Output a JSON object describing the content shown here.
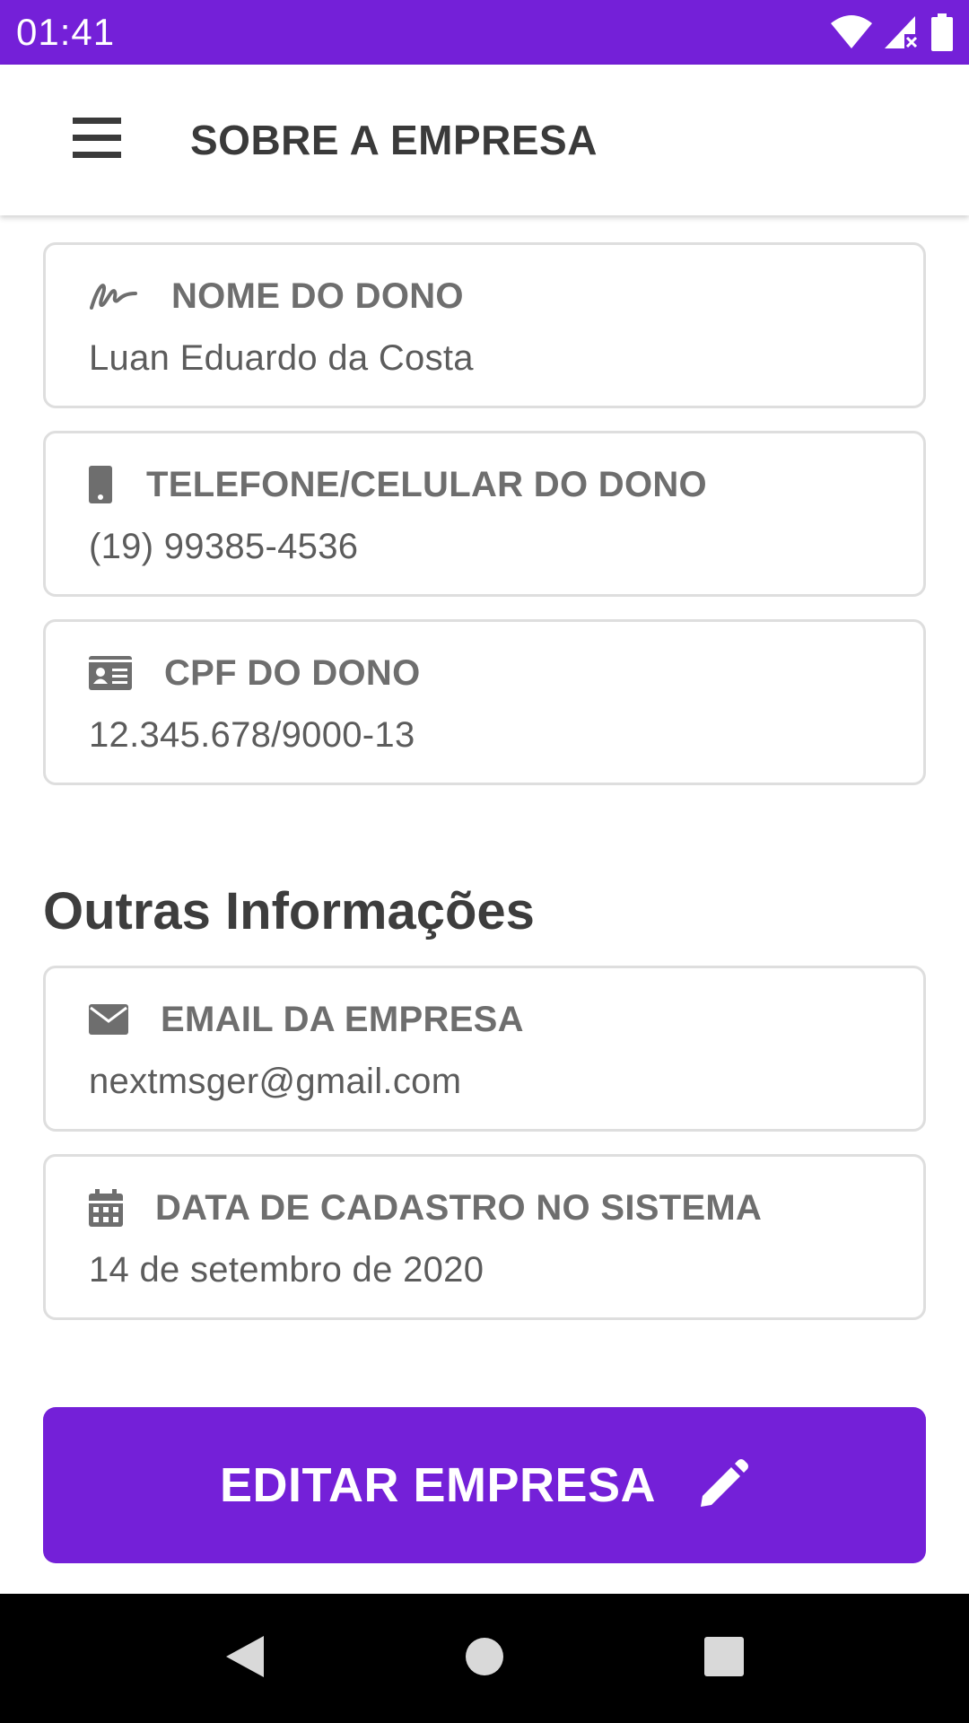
{
  "status_bar": {
    "time": "01:41",
    "icons": [
      "wifi-icon",
      "cell-signal-icon",
      "battery-icon"
    ],
    "color": "#7420d8"
  },
  "app_bar": {
    "title": "SOBRE A EMPRESA",
    "menu_icon": "hamburger-menu-icon"
  },
  "owner_cards": [
    {
      "icon": "signature-icon",
      "label": "NOME DO DONO",
      "value": "Luan Eduardo da Costa"
    },
    {
      "icon": "phone-icon",
      "label": "TELEFONE/CELULAR DO DONO",
      "value": "(19) 99385-4536"
    },
    {
      "icon": "id-card-icon",
      "label": "CPF DO DONO",
      "value": "12.345.678/9000-13"
    }
  ],
  "other_section": {
    "title": "Outras Informações",
    "cards": [
      {
        "icon": "envelope-icon",
        "label": "EMAIL DA EMPRESA",
        "value": "nextmsger@gmail.com"
      },
      {
        "icon": "calendar-icon",
        "label": "DATA DE CADASTRO NO SISTEMA",
        "value": "14 de setembro de 2020"
      }
    ]
  },
  "edit_button": {
    "label": "EDITAR EMPRESA",
    "icon": "pencil-icon",
    "color": "#7420d8"
  },
  "nav_bar": {
    "buttons": [
      "back-icon",
      "home-icon",
      "recents-icon"
    ]
  }
}
